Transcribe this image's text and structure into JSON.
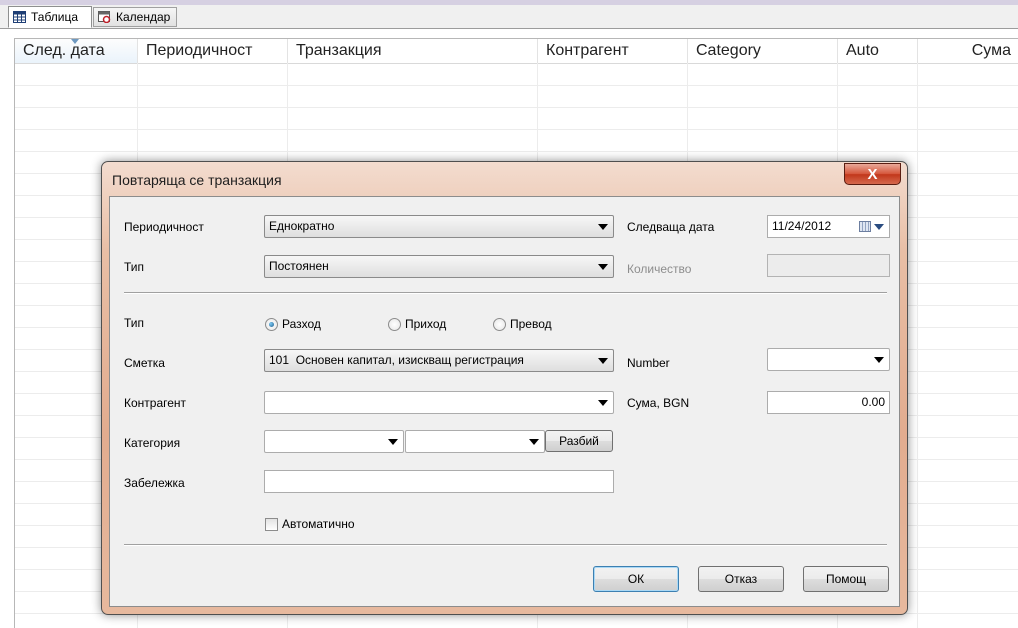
{
  "tabs": [
    {
      "label": "Таблица",
      "icon": "table-icon",
      "active": true
    },
    {
      "label": "Календар",
      "icon": "calendar-icon",
      "active": false
    }
  ],
  "grid": {
    "columns": [
      "След. дата",
      "Периодичност",
      "Транзакция",
      "Контрагент",
      "Category",
      "Auto",
      "Сума"
    ]
  },
  "dialog": {
    "title": "Повтаряща се транзакция",
    "close_label": "X",
    "periodicity": {
      "label": "Периодичност",
      "value": "Еднократно"
    },
    "next_date": {
      "label": "Следваща дата",
      "value": "11/24/2012"
    },
    "schedule_type": {
      "label": "Тип",
      "value": "Постоянен"
    },
    "quantity": {
      "label": "Количество",
      "value": ""
    },
    "tx_type": {
      "label": "Тип",
      "options": [
        "Разход",
        "Приход",
        "Превод"
      ],
      "selected": "Разход"
    },
    "account": {
      "label": "Сметка",
      "value": "101  Основен капитал, изискващ регистрация"
    },
    "number": {
      "label": "Number",
      "value": ""
    },
    "payee": {
      "label": "Контрагент",
      "value": ""
    },
    "amount": {
      "label": "Сума, BGN",
      "value": "0.00"
    },
    "category": {
      "label": "Категория",
      "value1": "",
      "value2": "",
      "split_label": "Разбий"
    },
    "memo": {
      "label": "Забележка",
      "value": ""
    },
    "auto": {
      "label": "Автоматично",
      "checked": false
    },
    "buttons": {
      "ok": "ОК",
      "cancel": "Отказ",
      "help": "Помощ"
    }
  }
}
